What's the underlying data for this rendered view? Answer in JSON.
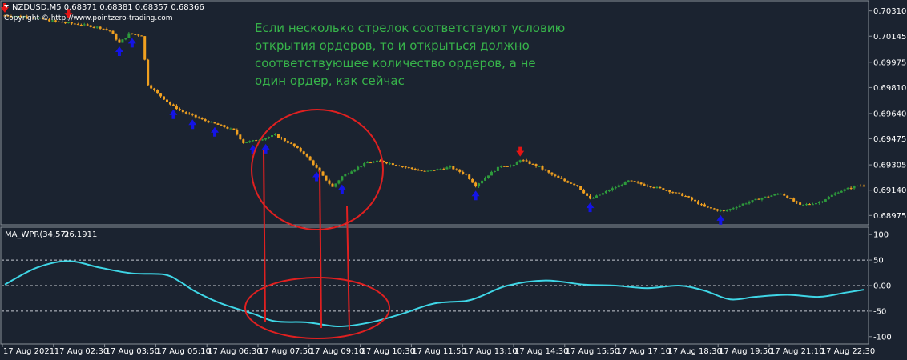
{
  "header": {
    "symbol_line": "NZDUSD,M5  0.68371 0.68381 0.68357 0.68366",
    "copyright": "Copyright © http://www.pointzero-trading.com"
  },
  "annotation": {
    "lines": [
      "Если несколько стрелок соответствуют условию",
      "открытия ордеров, то и открыться должно",
      "соответствующее количество ордеров, а не",
      "один ордер, как сейчас"
    ]
  },
  "colors": {
    "background": "#1b2330",
    "bull": "#2e9b3c",
    "bear": "#f0a020",
    "buy_arrow": "#1414e6",
    "sell_arrow": "#e61414",
    "wpr_line": "#3fd6e6",
    "markup": "#e02020",
    "annotation_text": "#37b34a"
  },
  "chart_data": [
    {
      "type": "candlestick",
      "title": "NZDUSD,M5",
      "ohlc_last": {
        "open": 0.68371,
        "high": 0.68381,
        "low": 0.68357,
        "close": 0.68366
      },
      "ylim": [
        0.6894,
        0.7035
      ],
      "y_ticks": [
        "0.70310",
        "0.70145",
        "0.69975",
        "0.69810",
        "0.69640",
        "0.69475",
        "0.69305",
        "0.69140",
        "0.68975"
      ],
      "x_ticks": [
        "17 Aug 2021",
        "17 Aug 02:30",
        "17 Aug 03:50",
        "17 Aug 05:10",
        "17 Aug 06:30",
        "17 Aug 07:50",
        "17 Aug 09:10",
        "17 Aug 10:30",
        "17 Aug 11:50",
        "17 Aug 13:10",
        "17 Aug 14:30",
        "17 Aug 15:50",
        "17 Aug 17:10",
        "17 Aug 18:30",
        "17 Aug 19:50",
        "17 Aug 21:10",
        "17 Aug 22:30"
      ],
      "close_path": [
        [
          0,
          0.7028
        ],
        [
          8,
          0.7027
        ],
        [
          16,
          0.7024
        ],
        [
          24,
          0.7022
        ],
        [
          30,
          0.702
        ],
        [
          33,
          0.7018
        ],
        [
          36,
          0.701
        ],
        [
          39,
          0.7016
        ],
        [
          43,
          0.7015
        ],
        [
          45,
          0.6983
        ],
        [
          47,
          0.6979
        ],
        [
          52,
          0.697
        ],
        [
          56,
          0.6965
        ],
        [
          62,
          0.696
        ],
        [
          68,
          0.6956
        ],
        [
          72,
          0.6953
        ],
        [
          75,
          0.6945
        ],
        [
          80,
          0.6947
        ],
        [
          85,
          0.695
        ],
        [
          90,
          0.6944
        ],
        [
          94,
          0.6938
        ],
        [
          97,
          0.6931
        ],
        [
          100,
          0.6923
        ],
        [
          103,
          0.6916
        ],
        [
          106,
          0.6923
        ],
        [
          110,
          0.6928
        ],
        [
          114,
          0.6932
        ],
        [
          118,
          0.6933
        ],
        [
          124,
          0.693
        ],
        [
          132,
          0.6926
        ],
        [
          140,
          0.6929
        ],
        [
          145,
          0.6924
        ],
        [
          148,
          0.6917
        ],
        [
          152,
          0.6924
        ],
        [
          156,
          0.693
        ],
        [
          160,
          0.693
        ],
        [
          162,
          0.6934
        ],
        [
          168,
          0.6929
        ],
        [
          172,
          0.6924
        ],
        [
          176,
          0.692
        ],
        [
          180,
          0.6917
        ],
        [
          184,
          0.6908
        ],
        [
          190,
          0.6914
        ],
        [
          196,
          0.692
        ],
        [
          202,
          0.6917
        ],
        [
          208,
          0.6914
        ],
        [
          214,
          0.691
        ],
        [
          220,
          0.6903
        ],
        [
          226,
          0.69
        ],
        [
          232,
          0.6905
        ],
        [
          238,
          0.6909
        ],
        [
          244,
          0.6912
        ],
        [
          250,
          0.6904
        ],
        [
          256,
          0.6906
        ],
        [
          262,
          0.6913
        ],
        [
          268,
          0.6917
        ]
      ],
      "buy_arrows": [
        36,
        40,
        53,
        59,
        66,
        78,
        82,
        98,
        106,
        148,
        184,
        225
      ],
      "sell_arrows": [
        0,
        20,
        162
      ]
    },
    {
      "type": "line",
      "title": "MA_WPR(34,57)",
      "series": [
        {
          "name": "MA_WPR(34,57)",
          "last_value": 26.1911
        }
      ],
      "ylim": [
        -105,
        105
      ],
      "y_ticks": [
        100,
        50,
        0,
        -50,
        -100
      ],
      "y_tick_labels": [
        "100",
        "50",
        "0.00",
        "-50",
        "-100"
      ],
      "levels": [
        50,
        0,
        -50
      ],
      "x": [
        0,
        10,
        20,
        30,
        40,
        50,
        55,
        60,
        68,
        78,
        85,
        95,
        105,
        115,
        125,
        135,
        145,
        150,
        158,
        170,
        182,
        192,
        202,
        212,
        220,
        228,
        236,
        246,
        256,
        264,
        270
      ],
      "values": [
        2,
        35,
        48,
        35,
        24,
        22,
        8,
        -12,
        -35,
        -55,
        -70,
        -72,
        -80,
        -72,
        -55,
        -35,
        -30,
        -20,
        0,
        10,
        2,
        0,
        -5,
        0,
        -10,
        -27,
        -22,
        -18,
        -22,
        -14,
        -8
      ]
    }
  ]
}
